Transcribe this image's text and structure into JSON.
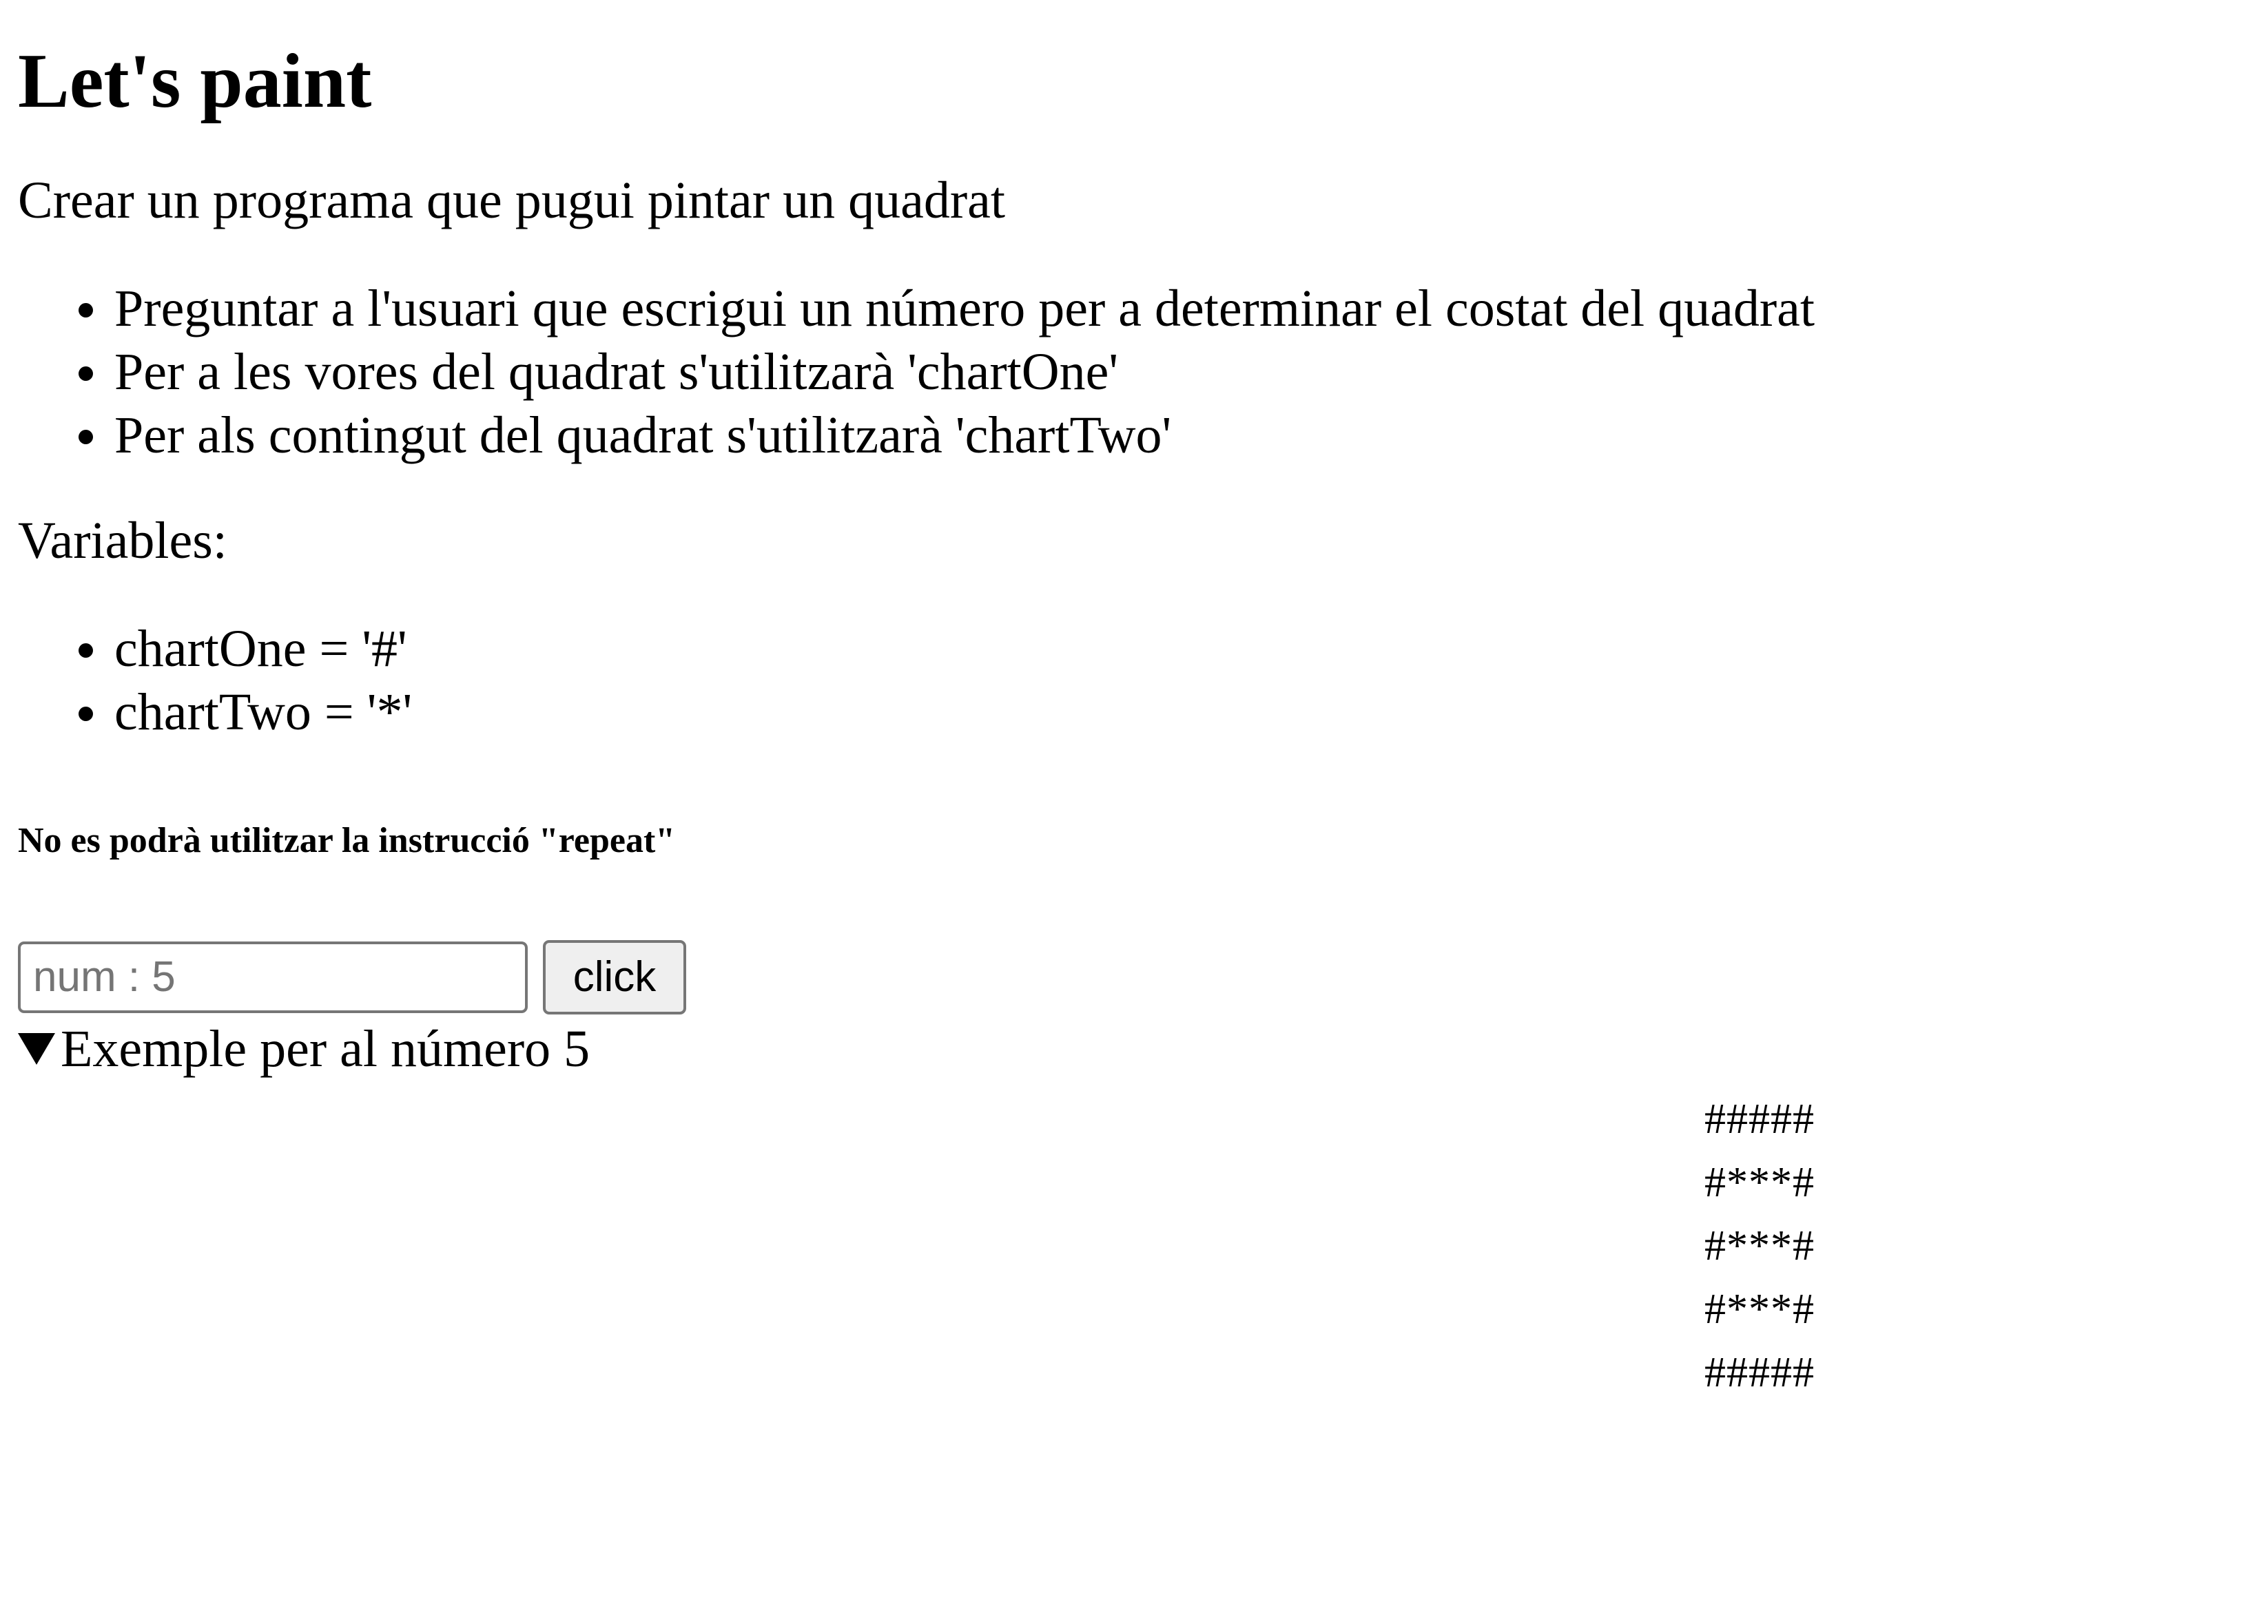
{
  "title": "Let's paint",
  "description": "Crear un programa que pugui pintar un quadrat",
  "requirements": [
    "Preguntar a l'usuari que escrigui un número per a determinar el costat del quadrat",
    "Per a les vores del quadrat s'utilitzarà 'chartOne'",
    "Per als contingut del quadrat s'utilitzarà 'chartTwo'"
  ],
  "variables_label": "Variables:",
  "variables": [
    "chartOne = '#'",
    "chartTwo = '*'"
  ],
  "warning": "No es podrà utilitzar la instrucció \"repeat\"",
  "form": {
    "input_value": "",
    "input_placeholder": "num : 5",
    "button_label": "click"
  },
  "example": {
    "summary": "Exemple per al número 5",
    "lines": [
      "#####",
      "#***#",
      "#***#",
      "#***#",
      "#####"
    ]
  }
}
